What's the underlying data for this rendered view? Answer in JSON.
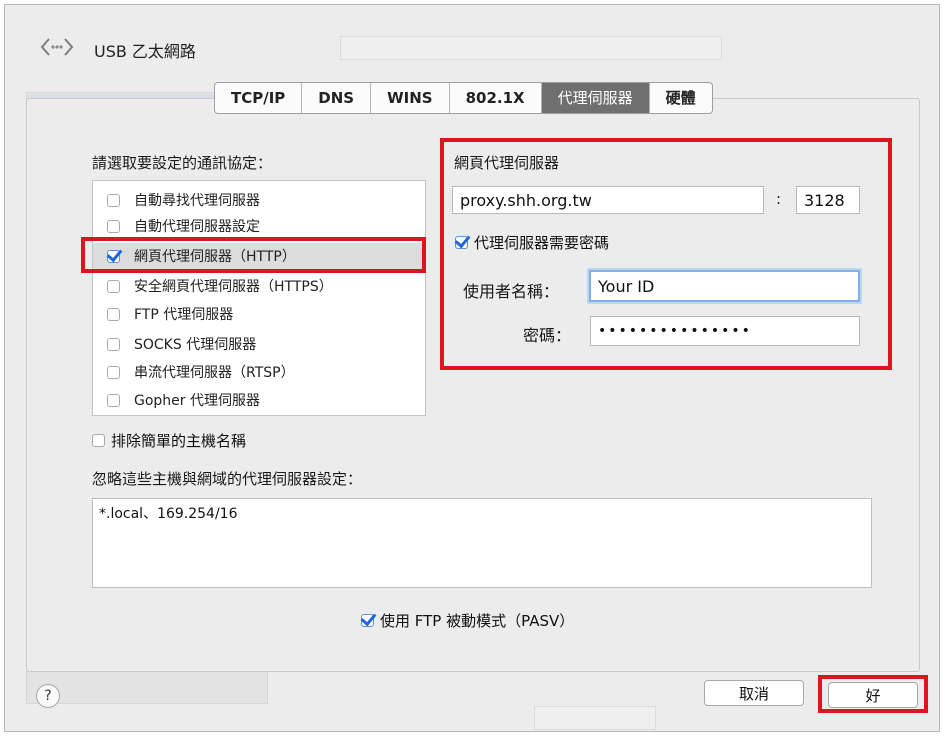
{
  "window": {
    "title": "USB 乙太網路"
  },
  "tabs": [
    {
      "label": "TCP/IP",
      "active": false
    },
    {
      "label": "DNS",
      "active": false
    },
    {
      "label": "WINS",
      "active": false
    },
    {
      "label": "802.1X",
      "active": false
    },
    {
      "label": "代理伺服器",
      "active": true
    },
    {
      "label": "硬體",
      "active": false
    }
  ],
  "protocols": {
    "heading": "請選取要設定的通訊協定：",
    "items": [
      {
        "label": "自動尋找代理伺服器",
        "checked": false
      },
      {
        "label": "自動代理伺服器設定",
        "checked": false
      },
      {
        "label": "網頁代理伺服器（HTTP）",
        "checked": true
      },
      {
        "label": "安全網頁代理伺服器（HTTPS）",
        "checked": false
      },
      {
        "label": "FTP 代理伺服器",
        "checked": false
      },
      {
        "label": "SOCKS 代理伺服器",
        "checked": false
      },
      {
        "label": "串流代理伺服器（RTSP）",
        "checked": false
      },
      {
        "label": "Gopher 代理伺服器",
        "checked": false
      }
    ]
  },
  "proxy": {
    "heading": "網頁代理伺服器",
    "server": "proxy.shh.org.tw",
    "colon": ":",
    "port": "3128",
    "requires_password_label": "代理伺服器需要密碼",
    "requires_password": true,
    "username_label": "使用者名稱：",
    "username": "Your ID",
    "password_label": "密碼：",
    "password": "•••••••••••••••"
  },
  "exclude_simple": {
    "label": "排除簡單的主機名稱",
    "checked": false
  },
  "bypass": {
    "label": "忽略這些主機與網域的代理伺服器設定：",
    "value": "*.local、169.254/16"
  },
  "pasv": {
    "label": "使用 FTP 被動模式（PASV）",
    "checked": true
  },
  "buttons": {
    "help": "?",
    "cancel": "取消",
    "ok": "好"
  },
  "colors": {
    "highlight_red": "#e0141e",
    "accent_blue": "#2066d6"
  }
}
